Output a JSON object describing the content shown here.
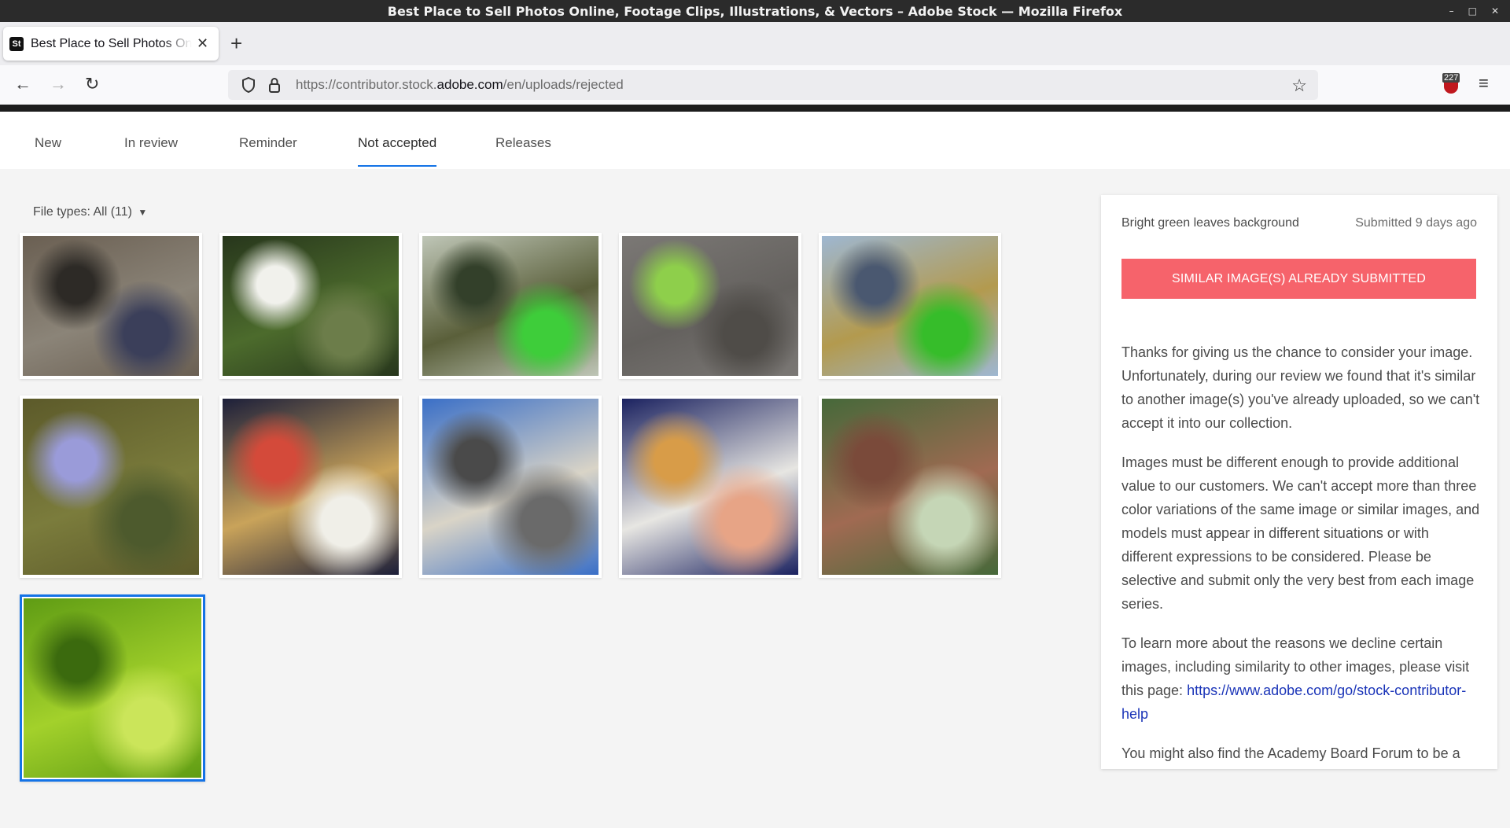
{
  "window": {
    "title": "Best Place to Sell Photos Online, Footage Clips, Illustrations, & Vectors – Adobe Stock — Mozilla Firefox"
  },
  "browser": {
    "tab_title": "Best Place to Sell Photos Online, Footage Clips, Illustrations, & Vectors – Adobe Stock",
    "favicon_text": "St",
    "url_prefix": "https://contributor.stock.",
    "url_domain": "adobe.com",
    "url_path": "/en/uploads/rejected",
    "extension_badge": "227"
  },
  "tabs": [
    {
      "label": "New"
    },
    {
      "label": "In review"
    },
    {
      "label": "Reminder"
    },
    {
      "label": "Not accepted",
      "active": true
    },
    {
      "label": "Releases"
    }
  ],
  "filter": {
    "label": "File types: All (11)"
  },
  "thumbnails": [
    {
      "name": "thumb-boots-on-wood",
      "colors": [
        "#6a5f52",
        "#8b8478",
        "#2d2a26",
        "#3b3f5a"
      ]
    },
    {
      "name": "thumb-white-flowers",
      "colors": [
        "#27361c",
        "#4c6b2c",
        "#f1f1ec",
        "#6c7d4a"
      ]
    },
    {
      "name": "thumb-kayak-dock",
      "colors": [
        "#bfc6b7",
        "#5a5f3a",
        "#33402a",
        "#3ecd3a"
      ]
    },
    {
      "name": "thumb-leaf-on-asphalt",
      "colors": [
        "#7b7875",
        "#64615e",
        "#8ecf4b",
        "#4f4c48"
      ]
    },
    {
      "name": "thumb-kayak-river",
      "colors": [
        "#9eb7d1",
        "#b39a4e",
        "#4a5870",
        "#36bd2a"
      ]
    },
    {
      "name": "thumb-purple-flower",
      "colors": [
        "#5c5a2a",
        "#7b7c3c",
        "#9a9bd9",
        "#4d5a2d"
      ]
    },
    {
      "name": "thumb-food-plate",
      "colors": [
        "#1c1f3a",
        "#c9a35a",
        "#d44a3a",
        "#f0efe8"
      ]
    },
    {
      "name": "thumb-bridge-road",
      "colors": [
        "#3a6fc7",
        "#d9d4c7",
        "#4a4a4a",
        "#6a6a6a"
      ]
    },
    {
      "name": "thumb-shrimp-crackers",
      "colors": [
        "#1b2260",
        "#e7e6e2",
        "#d89c48",
        "#e7a486"
      ]
    },
    {
      "name": "thumb-wood-pile",
      "colors": [
        "#46693a",
        "#a06a52",
        "#7a4a3a",
        "#c5d6b6"
      ]
    },
    {
      "name": "thumb-green-leaves",
      "colors": [
        "#5f9c14",
        "#a3d12b",
        "#3b6a0e",
        "#cbe55a"
      ]
    }
  ],
  "panel": {
    "image_name": "Bright green leaves background",
    "submitted": "Submitted 9 days ago",
    "status": "SIMILAR IMAGE(S) ALREADY SUBMITTED",
    "paragraph1": "Thanks for giving us the chance to consider your image. Unfortunately, during our review we found that it's similar to another image(s) you've already uploaded, so we can't accept it into our collection.",
    "paragraph2": "Images must be different enough to provide additional value to our customers. We can't accept more than three color variations of the same image or similar images, and models must appear in different situations or with different expressions to be considered. Please be selective and submit only the very best from each image series.",
    "paragraph3_text": "To learn more about the reasons we decline certain images, including similarity to other images, please visit this page: ",
    "paragraph3_link": "https://www.adobe.com/go/stock-contributor-help",
    "paragraph4": "You might also find the Academy Board Forum to be a"
  },
  "colors": {
    "accent": "#1473e6",
    "status_banner": "#f6636b"
  }
}
